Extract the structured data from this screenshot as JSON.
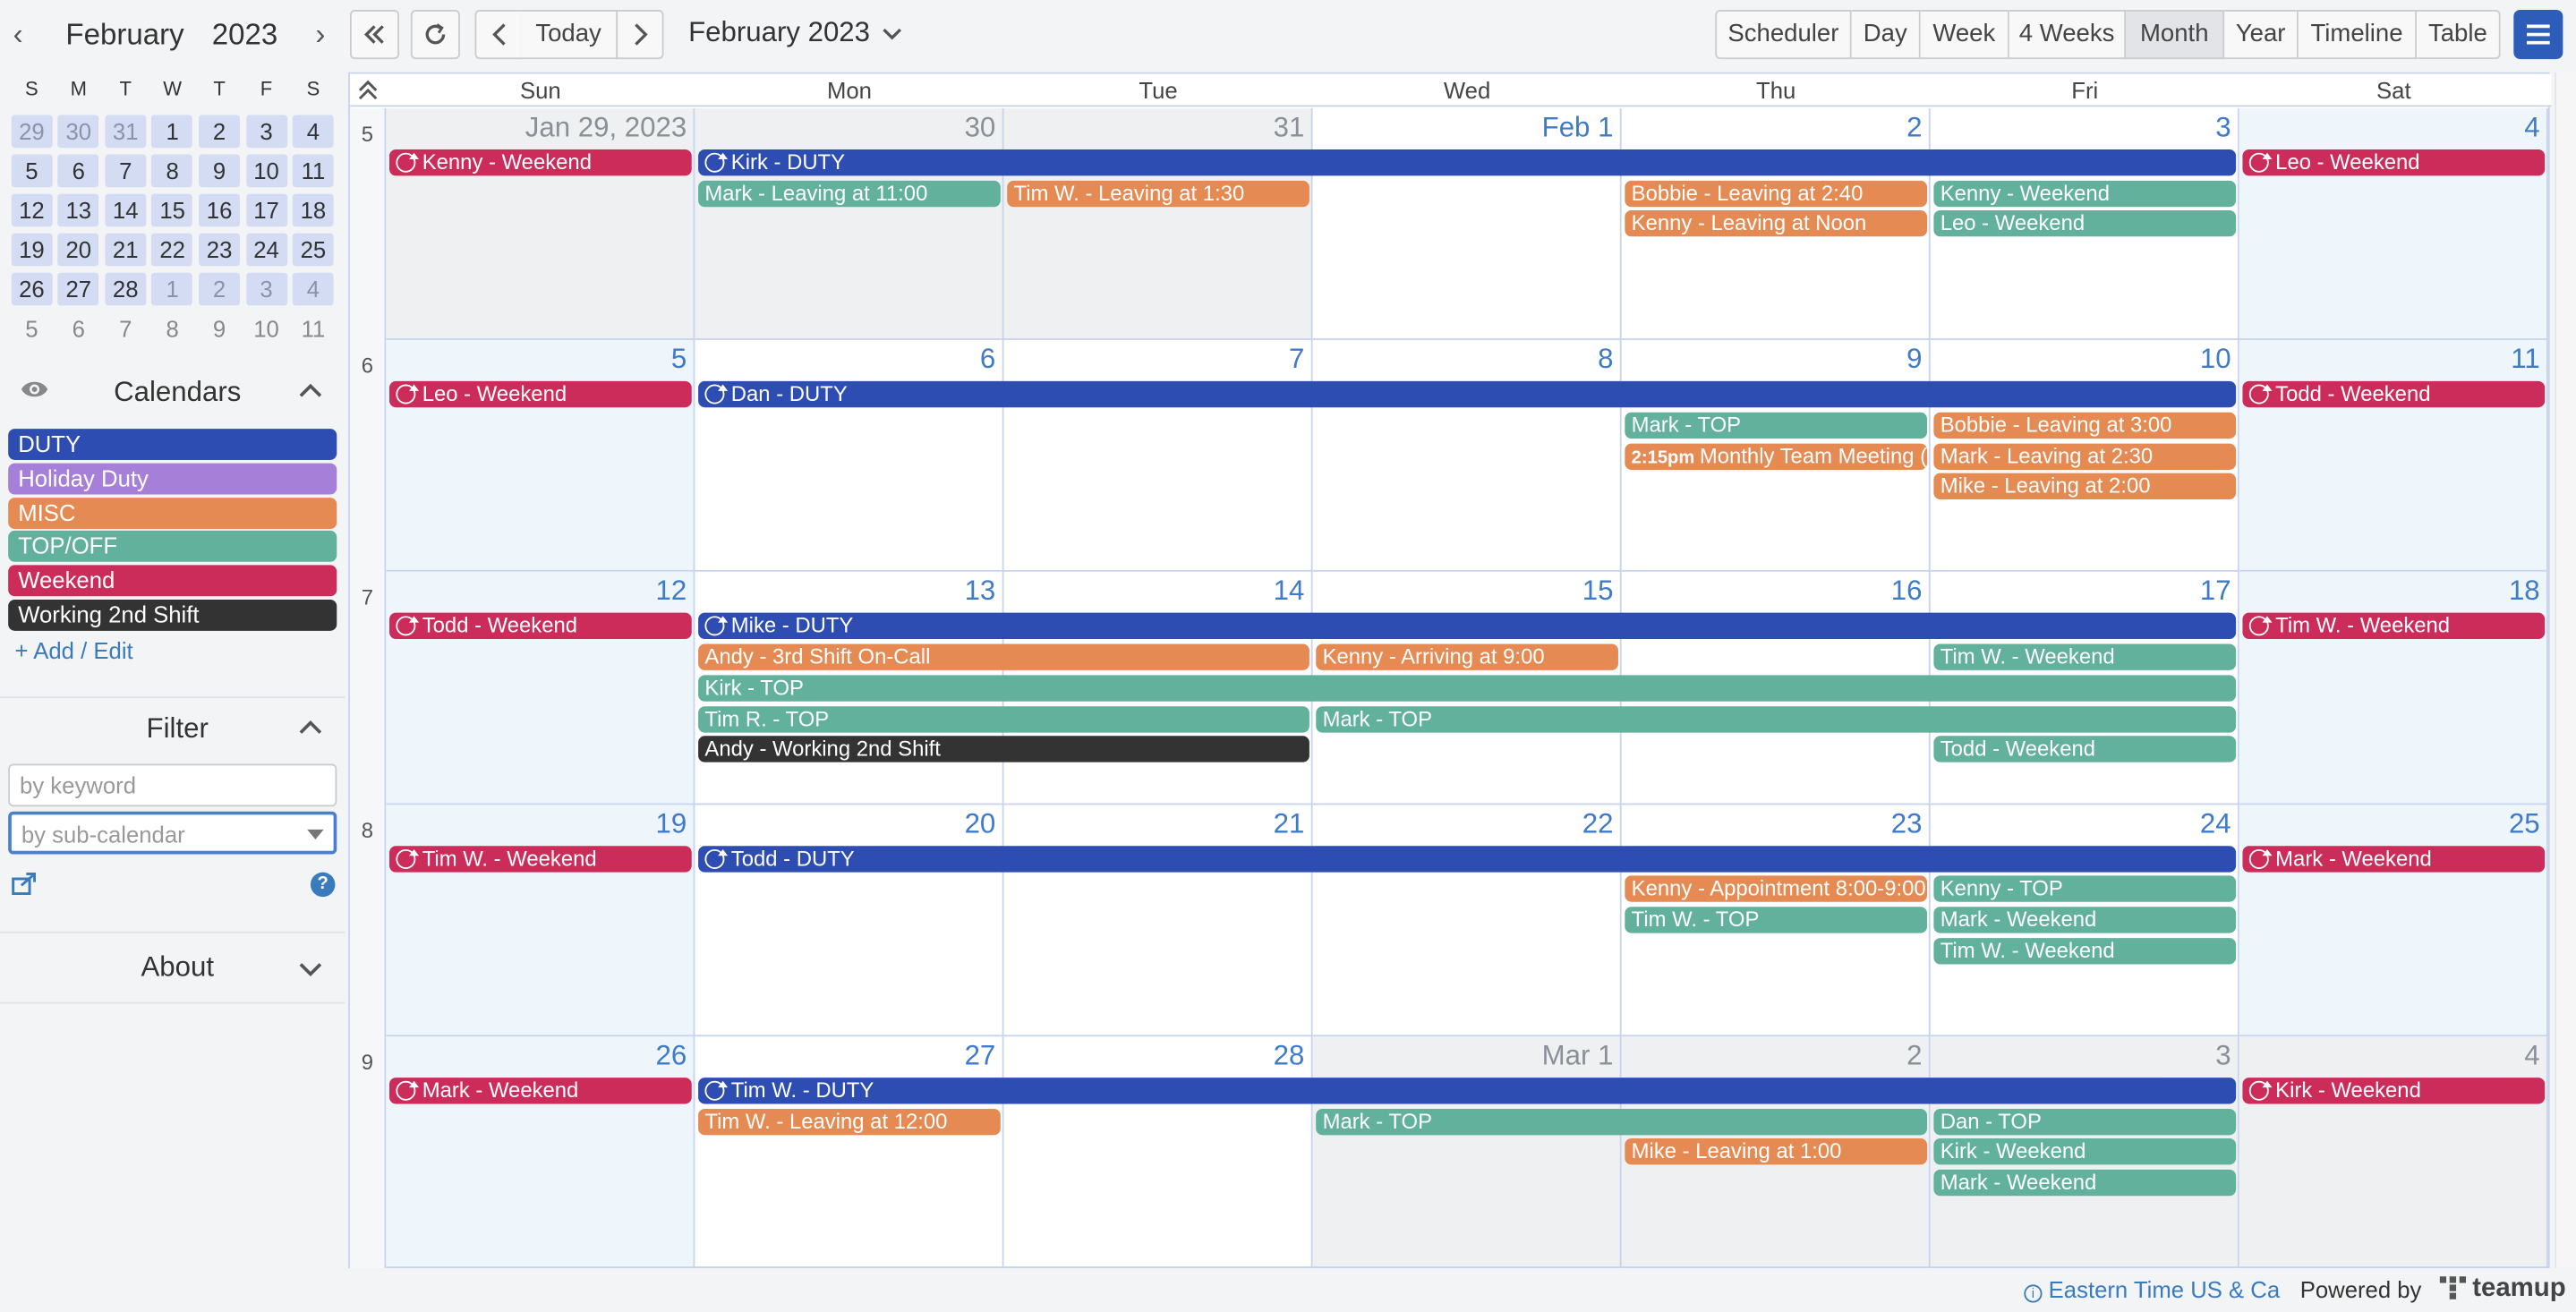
{
  "mini": {
    "month": "February",
    "year": "2023",
    "dow": [
      "S",
      "M",
      "T",
      "W",
      "T",
      "F",
      "S"
    ],
    "weeks": [
      [
        "29",
        "30",
        "31",
        "1",
        "2",
        "3",
        "4"
      ],
      [
        "5",
        "6",
        "7",
        "8",
        "9",
        "10",
        "11"
      ],
      [
        "12",
        "13",
        "14",
        "15",
        "16",
        "17",
        "18"
      ],
      [
        "19",
        "20",
        "21",
        "22",
        "23",
        "24",
        "25"
      ],
      [
        "26",
        "27",
        "28",
        "1",
        "2",
        "3",
        "4"
      ],
      [
        "5",
        "6",
        "7",
        "8",
        "9",
        "10",
        "11"
      ]
    ]
  },
  "calendars": {
    "title": "Calendars",
    "items": [
      {
        "label": "DUTY",
        "color": "#2e4db2"
      },
      {
        "label": "Holiday Duty",
        "color": "#a67fd8"
      },
      {
        "label": "MISC",
        "color": "#e68a53"
      },
      {
        "label": "TOP/OFF",
        "color": "#61b19c"
      },
      {
        "label": "Weekend",
        "color": "#cc2c5a"
      },
      {
        "label": "Working 2nd Shift",
        "color": "#333333"
      }
    ],
    "add_edit": "+ Add / Edit"
  },
  "filter": {
    "title": "Filter",
    "keyword_placeholder": "by keyword",
    "subcal_placeholder": "by sub-calendar"
  },
  "about": {
    "title": "About"
  },
  "toolbar": {
    "today": "Today",
    "title": "February 2023",
    "views": [
      "Scheduler",
      "Day",
      "Week",
      "4 Weeks",
      "Month",
      "Year",
      "Timeline",
      "Table"
    ],
    "active_view": "Month"
  },
  "dow_headers": [
    "Sun",
    "Mon",
    "Tue",
    "Wed",
    "Thu",
    "Fri",
    "Sat"
  ],
  "weeks": [
    {
      "num": "5",
      "days": [
        "Jan 29, 2023",
        "30",
        "31",
        "Feb 1",
        "2",
        "3",
        "4"
      ]
    },
    {
      "num": "6",
      "days": [
        "5",
        "6",
        "7",
        "8",
        "9",
        "10",
        "11"
      ]
    },
    {
      "num": "7",
      "days": [
        "12",
        "13",
        "14",
        "15",
        "16",
        "17",
        "18"
      ]
    },
    {
      "num": "8",
      "days": [
        "19",
        "20",
        "21",
        "22",
        "23",
        "24",
        "25"
      ]
    },
    {
      "num": "9",
      "days": [
        "26",
        "27",
        "28",
        "Mar 1",
        "2",
        "3",
        "4"
      ]
    }
  ],
  "events": [
    {
      "week": 0,
      "start": 0,
      "span": 1,
      "row": 0,
      "cal": "we",
      "rc": true,
      "title": "Kenny - Weekend"
    },
    {
      "week": 0,
      "start": 1,
      "span": 5,
      "row": 0,
      "cal": "duty",
      "rc": true,
      "title": "Kirk - DUTY"
    },
    {
      "week": 0,
      "start": 6,
      "span": 1,
      "row": 0,
      "cal": "we",
      "rc": true,
      "title": "Leo - Weekend"
    },
    {
      "week": 0,
      "start": 1,
      "span": 1,
      "row": 1,
      "cal": "top",
      "title": "Mark - Leaving at 11:00"
    },
    {
      "week": 0,
      "start": 2,
      "span": 1,
      "row": 1,
      "cal": "misc",
      "title": "Tim W. - Leaving at 1:30"
    },
    {
      "week": 0,
      "start": 4,
      "span": 1,
      "row": 1,
      "cal": "misc",
      "title": "Bobbie - Leaving at 2:40"
    },
    {
      "week": 0,
      "start": 5,
      "span": 1,
      "row": 1,
      "cal": "top",
      "title": "Kenny - Weekend"
    },
    {
      "week": 0,
      "start": 4,
      "span": 1,
      "row": 2,
      "cal": "misc",
      "title": "Kenny - Leaving at Noon"
    },
    {
      "week": 0,
      "start": 5,
      "span": 1,
      "row": 2,
      "cal": "top",
      "title": "Leo - Weekend"
    },
    {
      "week": 1,
      "start": 0,
      "span": 1,
      "row": 0,
      "cal": "we",
      "rc": true,
      "title": "Leo - Weekend"
    },
    {
      "week": 1,
      "start": 1,
      "span": 5,
      "row": 0,
      "cal": "duty",
      "rc": true,
      "title": "Dan - DUTY"
    },
    {
      "week": 1,
      "start": 6,
      "span": 1,
      "row": 0,
      "cal": "we",
      "rc": true,
      "title": "Todd - Weekend"
    },
    {
      "week": 1,
      "start": 4,
      "span": 1,
      "row": 1,
      "cal": "top",
      "title": "Mark - TOP"
    },
    {
      "week": 1,
      "start": 5,
      "span": 1,
      "row": 1,
      "cal": "misc",
      "title": "Bobbie - Leaving at 3:00"
    },
    {
      "week": 1,
      "start": 4,
      "span": 1,
      "row": 2,
      "cal": "misc",
      "time": "2:15pm",
      "title": "Monthly Team Meeting (Conf"
    },
    {
      "week": 1,
      "start": 5,
      "span": 1,
      "row": 2,
      "cal": "misc",
      "title": "Mark - Leaving at 2:30"
    },
    {
      "week": 1,
      "start": 5,
      "span": 1,
      "row": 3,
      "cal": "misc",
      "title": "Mike - Leaving at 2:00"
    },
    {
      "week": 2,
      "start": 0,
      "span": 1,
      "row": 0,
      "cal": "we",
      "rc": true,
      "title": "Todd - Weekend"
    },
    {
      "week": 2,
      "start": 1,
      "span": 5,
      "row": 0,
      "cal": "duty",
      "rc": true,
      "title": "Mike - DUTY"
    },
    {
      "week": 2,
      "start": 6,
      "span": 1,
      "row": 0,
      "cal": "we",
      "rc": true,
      "title": "Tim W. - Weekend"
    },
    {
      "week": 2,
      "start": 1,
      "span": 2,
      "row": 1,
      "cal": "misc",
      "title": "Andy - 3rd Shift On-Call"
    },
    {
      "week": 2,
      "start": 3,
      "span": 1,
      "row": 1,
      "cal": "misc",
      "title": "Kenny - Arriving at 9:00"
    },
    {
      "week": 2,
      "start": 5,
      "span": 1,
      "row": 1,
      "cal": "top",
      "title": "Tim W. - Weekend"
    },
    {
      "week": 2,
      "start": 1,
      "span": 5,
      "row": 2,
      "cal": "top",
      "title": "Kirk - TOP"
    },
    {
      "week": 2,
      "start": 1,
      "span": 2,
      "row": 3,
      "cal": "top",
      "title": "Tim R. - TOP"
    },
    {
      "week": 2,
      "start": 3,
      "span": 3,
      "row": 3,
      "cal": "top",
      "title": "Mark - TOP"
    },
    {
      "week": 2,
      "start": 1,
      "span": 2,
      "row": 4,
      "cal": "w2",
      "title": "Andy - Working 2nd Shift"
    },
    {
      "week": 2,
      "start": 5,
      "span": 1,
      "row": 4,
      "cal": "top",
      "title": "Todd - Weekend"
    },
    {
      "week": 3,
      "start": 0,
      "span": 1,
      "row": 0,
      "cal": "we",
      "rc": true,
      "title": "Tim W. - Weekend"
    },
    {
      "week": 3,
      "start": 1,
      "span": 5,
      "row": 0,
      "cal": "duty",
      "rc": true,
      "title": "Todd - DUTY"
    },
    {
      "week": 3,
      "start": 6,
      "span": 1,
      "row": 0,
      "cal": "we",
      "rc": true,
      "title": "Mark - Weekend"
    },
    {
      "week": 3,
      "start": 4,
      "span": 1,
      "row": 1,
      "cal": "misc",
      "title": "Kenny - Appointment 8:00-9:00"
    },
    {
      "week": 3,
      "start": 5,
      "span": 1,
      "row": 1,
      "cal": "top",
      "title": "Kenny - TOP"
    },
    {
      "week": 3,
      "start": 4,
      "span": 1,
      "row": 2,
      "cal": "top",
      "title": "Tim W. - TOP"
    },
    {
      "week": 3,
      "start": 5,
      "span": 1,
      "row": 2,
      "cal": "top",
      "title": "Mark - Weekend"
    },
    {
      "week": 3,
      "start": 5,
      "span": 1,
      "row": 3,
      "cal": "top",
      "title": "Tim W. - Weekend"
    },
    {
      "week": 4,
      "start": 0,
      "span": 1,
      "row": 0,
      "cal": "we",
      "rc": true,
      "title": "Mark - Weekend"
    },
    {
      "week": 4,
      "start": 1,
      "span": 5,
      "row": 0,
      "cal": "duty",
      "rc": true,
      "title": "Tim W. - DUTY"
    },
    {
      "week": 4,
      "start": 6,
      "span": 1,
      "row": 0,
      "cal": "we",
      "rc": true,
      "title": "Kirk - Weekend"
    },
    {
      "week": 4,
      "start": 1,
      "span": 1,
      "row": 1,
      "cal": "misc",
      "title": "Tim W. - Leaving at 12:00"
    },
    {
      "week": 4,
      "start": 3,
      "span": 2,
      "row": 1,
      "cal": "top",
      "title": "Mark - TOP"
    },
    {
      "week": 4,
      "start": 5,
      "span": 1,
      "row": 1,
      "cal": "top",
      "title": "Dan - TOP"
    },
    {
      "week": 4,
      "start": 4,
      "span": 1,
      "row": 2,
      "cal": "misc",
      "title": "Mike - Leaving at 1:00"
    },
    {
      "week": 4,
      "start": 5,
      "span": 1,
      "row": 2,
      "cal": "top",
      "title": "Kirk - Weekend"
    },
    {
      "week": 4,
      "start": 5,
      "span": 1,
      "row": 3,
      "cal": "top",
      "title": "Mark - Weekend"
    }
  ],
  "footer": {
    "timezone": "Eastern Time US & Ca",
    "powered": "Powered by",
    "brand": "teamup"
  }
}
